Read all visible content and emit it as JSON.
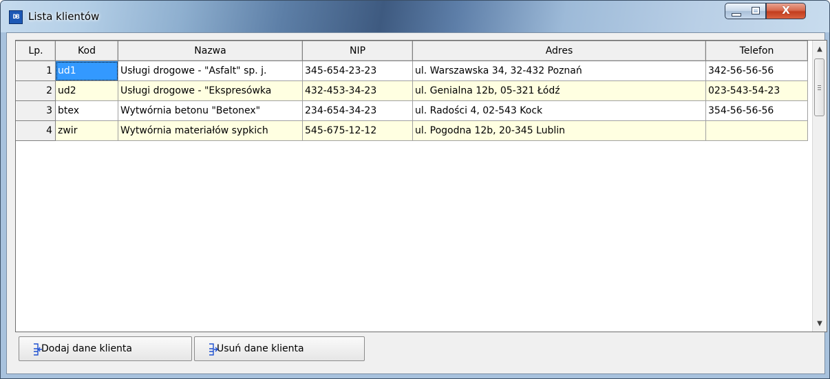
{
  "window": {
    "title": "Lista klientów",
    "icon": "app-icon",
    "icon_text": "DB",
    "controls": {
      "minimize": "minimize-icon",
      "maximize": "maximize-icon",
      "close_glyph": "X"
    }
  },
  "grid": {
    "columns": [
      "Lp.",
      "Kod",
      "Nazwa",
      "NIP",
      "Adres",
      "Telefon"
    ],
    "rows": [
      {
        "lp": "1",
        "kod": "ud1",
        "nazwa": "Usługi drogowe - \"Asfalt\" sp. j.",
        "nip": "345-654-23-23",
        "adres": "ul. Warszawska 34, 32-432 Poznań",
        "telefon": "342-56-56-56"
      },
      {
        "lp": "2",
        "kod": "ud2",
        "nazwa": "Usługi drogowe - \"Ekspresówka",
        "nip": "432-453-34-23",
        "adres": "ul. Genialna 12b, 05-321 Łódź",
        "telefon": "023-543-54-23"
      },
      {
        "lp": "3",
        "kod": "btex",
        "nazwa": "Wytwórnia betonu \"Betonex\"",
        "nip": "234-654-34-23",
        "adres": "ul. Radości 4, 02-543 Kock",
        "telefon": "354-56-56-56"
      },
      {
        "lp": "4",
        "kod": "zwir",
        "nazwa": "Wytwórnia materiałów sypkich",
        "nip": "545-675-12-12",
        "adres": "ul. Pogodna 12b, 20-345 Lublin",
        "telefon": ""
      }
    ],
    "row_colors": {
      "odd": "#ffffff",
      "even": "#ffffe1",
      "selected": "#3399ff"
    },
    "selected_cell": {
      "row": 0,
      "column": "kod"
    }
  },
  "buttons": {
    "add": {
      "label": "Dodaj dane klienta",
      "icon": "add-record-icon"
    },
    "delete": {
      "label": "Usuń dane klienta",
      "icon": "delete-record-icon"
    }
  }
}
